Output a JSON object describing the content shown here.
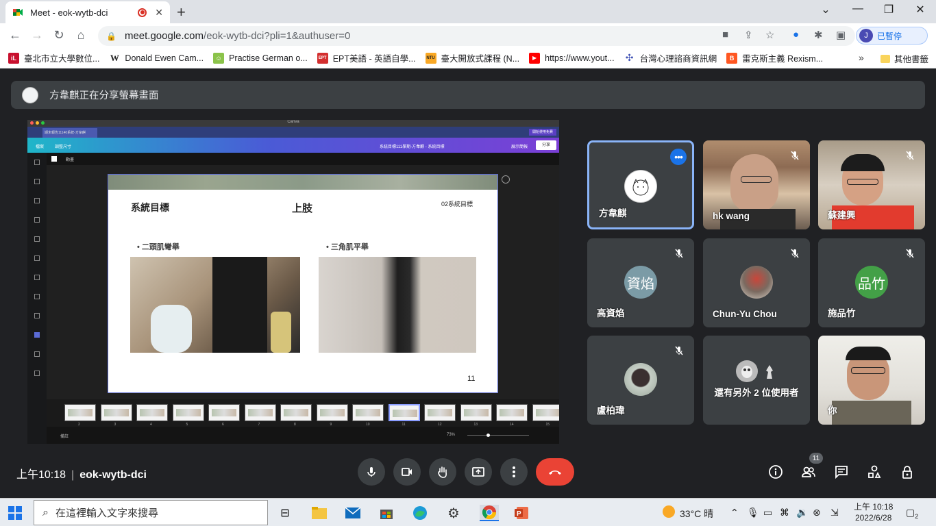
{
  "browser": {
    "tab_title": "Meet - eok-wytb-dci",
    "url_host": "meet.google.com",
    "url_path": "/eok-wytb-dci?pli=1&authuser=0",
    "profile_initial": "J",
    "profile_label": "已暫停",
    "window_controls": [
      "chevron-down-icon",
      "minimize-icon",
      "restore-icon",
      "close-icon"
    ]
  },
  "bookmarks": [
    {
      "label": "臺北市立大學數位...",
      "icon_color": "#c8102e",
      "icon_text": "iL"
    },
    {
      "label": "Donald Ewen Cam...",
      "icon_color": "#222222",
      "icon_text": "W"
    },
    {
      "label": "Practise German o...",
      "icon_color": "#8bc34a",
      "icon_text": "☺"
    },
    {
      "label": "EPT美語 - 英語自學...",
      "icon_color": "#d32f2f",
      "icon_text": "EPT"
    },
    {
      "label": "臺大開放式課程 (N...",
      "icon_color": "#f9a825",
      "icon_text": "NTU"
    },
    {
      "label": "https://www.yout...",
      "icon_color": "#ff0000",
      "icon_text": "▶"
    },
    {
      "label": "台灣心理諮商資訊網",
      "icon_color": "#3f51b5",
      "icon_text": "✣"
    },
    {
      "label": "雷克斯主義 Rexism...",
      "icon_color": "#ff5722",
      "icon_text": "B"
    }
  ],
  "bookmarks_other": "其他書籤",
  "meet": {
    "banner_text": "方韋麒正在分享螢幕畫面",
    "meeting_time": "上午10:18",
    "meeting_code": "eok-wytb-dci",
    "participant_count": "11"
  },
  "shared_screen": {
    "app_title": "Canva",
    "tab_label": "期末報告11140系統-方韋麒",
    "cta_label": "開始使用免費",
    "menu_home": "檔案",
    "menu_resize": "調整尺寸",
    "doc_title": "系統目標111學期-方韋麒 - 系統目標",
    "present_label": "展示簡報",
    "share_label": "分享",
    "edit_label": "動畫",
    "notes_label": "備註",
    "zoom": "73%",
    "slide": {
      "title": "系統目標",
      "subtitle": "上肢",
      "section": "02系統目標",
      "bullet1": "• 二頭肌彎舉",
      "bullet2": "• 三角肌平舉",
      "page_number": "11"
    },
    "filmstrip_numbers": [
      "2",
      "3",
      "4",
      "5",
      "6",
      "7",
      "8",
      "9",
      "10",
      "11",
      "12",
      "13",
      "14",
      "15",
      "16"
    ]
  },
  "participants": [
    {
      "name": "方韋麒",
      "initial": "",
      "avatar_color": "#ffffff",
      "muted": false,
      "active": true,
      "has_video": false
    },
    {
      "name": "hk wang",
      "muted": true,
      "has_video": true
    },
    {
      "name": "蘇建興",
      "muted": true,
      "has_video": true
    },
    {
      "name": "高資焰",
      "initial": "資焰",
      "avatar_color": "#7b9ba6",
      "muted": true,
      "has_video": false
    },
    {
      "name": "Chun-Yu Chou",
      "initial": "",
      "avatar_color": "#8a6b5a",
      "muted": true,
      "has_video": false
    },
    {
      "name": "施品竹",
      "initial": "品竹",
      "avatar_color": "#43a047",
      "muted": true,
      "has_video": false
    },
    {
      "name": "盧柏瑋",
      "initial": "",
      "avatar_color": "#9aa59a",
      "muted": true,
      "has_video": false
    },
    {
      "name": "還有另外 2 位使用者",
      "muted": false,
      "has_video": false
    },
    {
      "name": "你",
      "muted": false,
      "has_video": true
    }
  ],
  "taskbar": {
    "search_placeholder": "在這裡輸入文字來搜尋",
    "weather": "33°C 晴",
    "time": "上午 10:18",
    "date": "2022/6/28",
    "notifications": "2"
  }
}
